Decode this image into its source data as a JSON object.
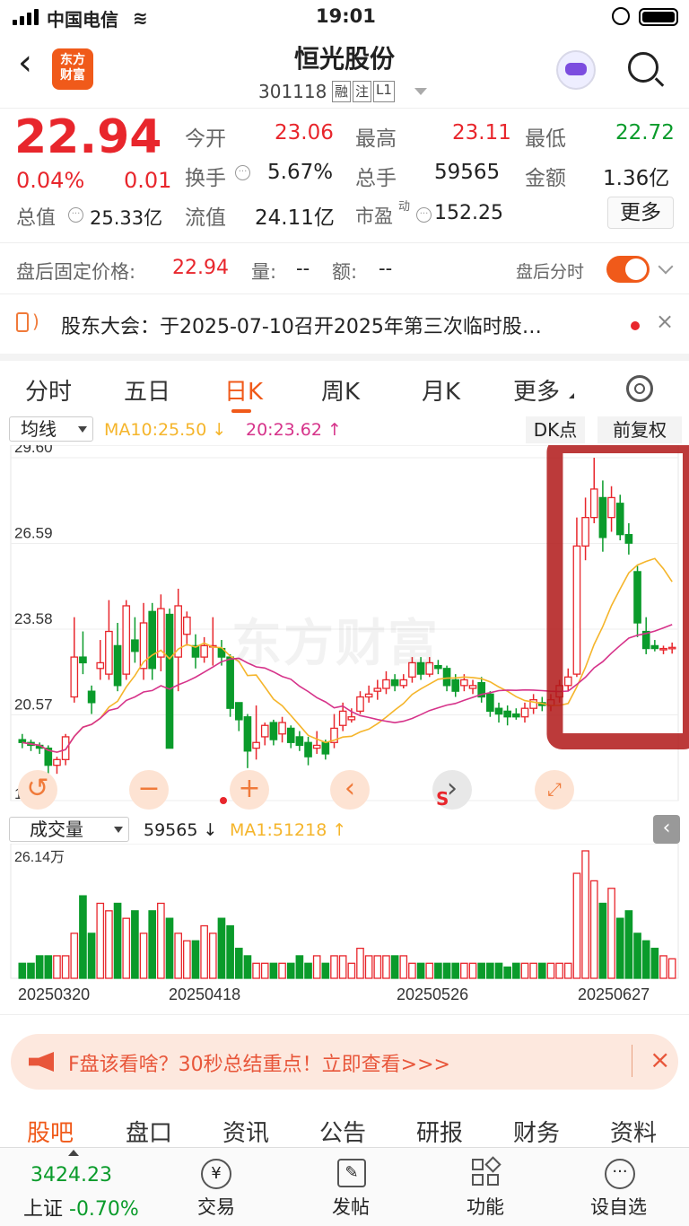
{
  "status": {
    "carrier": "中国电信",
    "time": "19:01"
  },
  "nav": {
    "title": "恒光股份",
    "code": "301118",
    "badges": [
      "融",
      "注",
      "L1"
    ],
    "logo": "东方\n财富"
  },
  "quote": {
    "price": "22.94",
    "change_pct": "0.04%",
    "change": "0.01",
    "total_mv_label": "总值",
    "total_mv": "25.33亿",
    "fields": [
      {
        "label": "今开",
        "value": "23.06"
      },
      {
        "label": "最高",
        "value": "23.11"
      },
      {
        "label": "最低",
        "value": "22.72"
      },
      {
        "label": "换手",
        "value": "5.67%"
      },
      {
        "label": "总手",
        "value": "59565"
      },
      {
        "label": "金额",
        "value": "1.36亿"
      },
      {
        "label": "流值",
        "value": "24.11亿"
      },
      {
        "label": "市盈",
        "value": "152.25"
      }
    ],
    "pe_sup": "动",
    "more": "更多"
  },
  "after_hours": {
    "label": "盘后固定价格:",
    "price": "22.94",
    "vol_label": "量:",
    "vol": "--",
    "amt_label": "额:",
    "amt": "--",
    "toggle_label": "盘后分时",
    "toggle_on": true
  },
  "notice": {
    "text": "股东大会：于2025-07-10召开2025年第三次临时股…"
  },
  "tabs": [
    "分时",
    "五日",
    "日K",
    "周K",
    "月K",
    "更多"
  ],
  "active_tab": 2,
  "chart": {
    "ma_select": "均线",
    "ma10": "MA10:25.50",
    "ma20": "20:23.62",
    "dk": "DK点",
    "fq": "前复权",
    "watermark": "东方财富",
    "price_ticks": [
      "29.60",
      "26.59",
      "23.58",
      "20.57",
      "17.56"
    ],
    "vol_select": "成交量",
    "vol_value": "59565",
    "vol_ma": "MA1:51218",
    "vol_top": "26.14万",
    "dates": [
      "20250320",
      "20250418",
      "20250526",
      "20250627"
    ],
    "s_mark": "S"
  },
  "chart_data": {
    "type": "candlestick",
    "ylim": [
      17.56,
      29.6
    ],
    "candles": [
      [
        19.7,
        19.6,
        19.9,
        19.4
      ],
      [
        19.6,
        19.5,
        19.7,
        19.3
      ],
      [
        19.5,
        19.4,
        19.6,
        19.2
      ],
      [
        19.4,
        18.8,
        19.5,
        18.3
      ],
      [
        18.8,
        19.0,
        19.1,
        18.5
      ],
      [
        19.0,
        19.8,
        19.9,
        18.8
      ],
      [
        21.2,
        22.6,
        24.0,
        21.0
      ],
      [
        22.6,
        22.4,
        23.5,
        22.0
      ],
      [
        21.4,
        21.0,
        21.6,
        20.6
      ],
      [
        22.2,
        22.4,
        23.2,
        21.8
      ],
      [
        22.0,
        23.5,
        24.6,
        21.8
      ],
      [
        23.0,
        21.6,
        23.8,
        21.4
      ],
      [
        22.0,
        24.4,
        24.6,
        21.8
      ],
      [
        23.2,
        22.8,
        24.0,
        22.4
      ],
      [
        22.2,
        23.8,
        24.5,
        21.8
      ],
      [
        24.2,
        22.2,
        24.5,
        21.8
      ],
      [
        22.6,
        24.3,
        24.8,
        22.1
      ],
      [
        24.1,
        19.4,
        24.3,
        19.4
      ],
      [
        22.6,
        24.4,
        25.0,
        21.4
      ],
      [
        23.4,
        24.0,
        24.2,
        23.0
      ],
      [
        23.0,
        22.6,
        23.4,
        22.2
      ],
      [
        22.6,
        23.0,
        23.3,
        22.4
      ],
      [
        23.0,
        23.0,
        24.0,
        22.3
      ],
      [
        22.9,
        22.6,
        23.2,
        22.3
      ],
      [
        22.6,
        20.8,
        22.7,
        20.5
      ],
      [
        21.0,
        20.4,
        21.0,
        20.0
      ],
      [
        20.5,
        19.3,
        20.6,
        18.7
      ],
      [
        19.4,
        19.6,
        20.9,
        19.0
      ],
      [
        19.8,
        20.2,
        20.3,
        19.5
      ],
      [
        20.3,
        19.7,
        20.4,
        19.5
      ],
      [
        19.9,
        20.3,
        20.5,
        19.6
      ],
      [
        20.1,
        19.6,
        20.2,
        19.4
      ],
      [
        19.8,
        19.5,
        20.0,
        19.3
      ],
      [
        19.6,
        19.1,
        19.8,
        18.8
      ],
      [
        19.4,
        19.5,
        20.0,
        19.2
      ],
      [
        19.6,
        19.2,
        19.7,
        19.0
      ],
      [
        19.6,
        20.1,
        20.6,
        19.4
      ],
      [
        20.2,
        20.7,
        21.0,
        20.0
      ],
      [
        20.4,
        20.5,
        20.8,
        20.3
      ],
      [
        20.7,
        21.2,
        21.4,
        20.6
      ],
      [
        21.2,
        21.3,
        21.6,
        21.0
      ],
      [
        21.4,
        21.5,
        21.8,
        21.1
      ],
      [
        21.5,
        21.8,
        22.1,
        21.3
      ],
      [
        21.8,
        21.6,
        22.0,
        21.4
      ],
      [
        21.6,
        21.8,
        22.0,
        21.5
      ],
      [
        21.9,
        22.4,
        22.6,
        21.7
      ],
      [
        22.4,
        22.0,
        22.6,
        21.8
      ],
      [
        22.0,
        22.4,
        22.6,
        21.9
      ],
      [
        22.3,
        22.2,
        22.5,
        22.0
      ],
      [
        22.2,
        21.6,
        22.3,
        21.4
      ],
      [
        21.8,
        21.4,
        22.0,
        21.2
      ],
      [
        21.6,
        21.8,
        22.0,
        21.4
      ],
      [
        21.5,
        21.6,
        21.8,
        21.3
      ],
      [
        21.7,
        21.2,
        21.9,
        21.0
      ],
      [
        21.3,
        20.7,
        21.4,
        20.5
      ],
      [
        20.8,
        20.6,
        21.0,
        20.3
      ],
      [
        20.7,
        20.5,
        20.9,
        20.2
      ],
      [
        20.6,
        20.5,
        20.8,
        20.4
      ],
      [
        20.5,
        20.8,
        21.0,
        20.3
      ],
      [
        20.8,
        21.1,
        21.3,
        20.6
      ],
      [
        21.0,
        20.9,
        21.2,
        20.7
      ],
      [
        20.9,
        21.1,
        21.3,
        20.7
      ],
      [
        21.2,
        21.6,
        21.8,
        21.0
      ],
      [
        21.6,
        21.9,
        22.2,
        21.4
      ],
      [
        22.0,
        26.5,
        27.5,
        21.9
      ],
      [
        26.5,
        27.5,
        28.2,
        26.0
      ],
      [
        27.5,
        28.5,
        29.6,
        27.3
      ],
      [
        28.2,
        26.8,
        28.8,
        26.3
      ],
      [
        27.5,
        28.2,
        28.6,
        27.0
      ],
      [
        28.0,
        26.9,
        28.3,
        26.7
      ],
      [
        26.9,
        26.6,
        27.3,
        26.2
      ],
      [
        25.6,
        23.8,
        25.8,
        23.3
      ],
      [
        23.5,
        22.9,
        24.0,
        22.7
      ],
      [
        23.0,
        22.9,
        23.2,
        22.8
      ],
      [
        22.9,
        22.9,
        23.0,
        22.7
      ],
      [
        22.9,
        22.94,
        23.11,
        22.72
      ]
    ],
    "volume_max": 26.14,
    "volume_unit": "万"
  }
}
